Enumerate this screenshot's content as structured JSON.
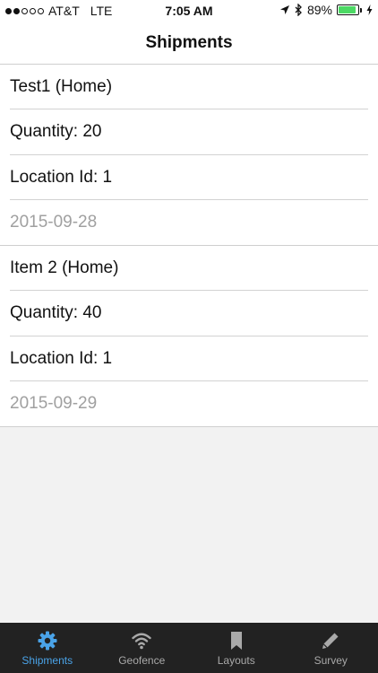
{
  "status_bar": {
    "carrier": "AT&T",
    "network": "LTE",
    "time": "7:05 AM",
    "battery_percent": "89%",
    "battery_level": 0.89,
    "signal_bars_filled": 2,
    "signal_bars_total": 5
  },
  "nav": {
    "title": "Shipments"
  },
  "shipments": [
    {
      "name": "Test1 (Home)",
      "quantity": "Quantity: 20",
      "location": "Location Id: 1",
      "date": "2015-09-28"
    },
    {
      "name": "Item 2 (Home)",
      "quantity": "Quantity: 40",
      "location": "Location Id: 1",
      "date": "2015-09-29"
    }
  ],
  "tab_bar": {
    "active": "Shipments",
    "tabs": [
      {
        "label": "Shipments",
        "icon": "gear-icon"
      },
      {
        "label": "Geofence",
        "icon": "wifi-icon"
      },
      {
        "label": "Layouts",
        "icon": "bookmark-icon"
      },
      {
        "label": "Survey",
        "icon": "pencil-icon"
      }
    ]
  },
  "colors": {
    "active_tab": "#4aa3e8",
    "inactive_tab": "#a9a9a9",
    "tab_bar_bg": "#222222",
    "battery_fill": "#4cd964",
    "date_text": "#a0a0a0"
  }
}
